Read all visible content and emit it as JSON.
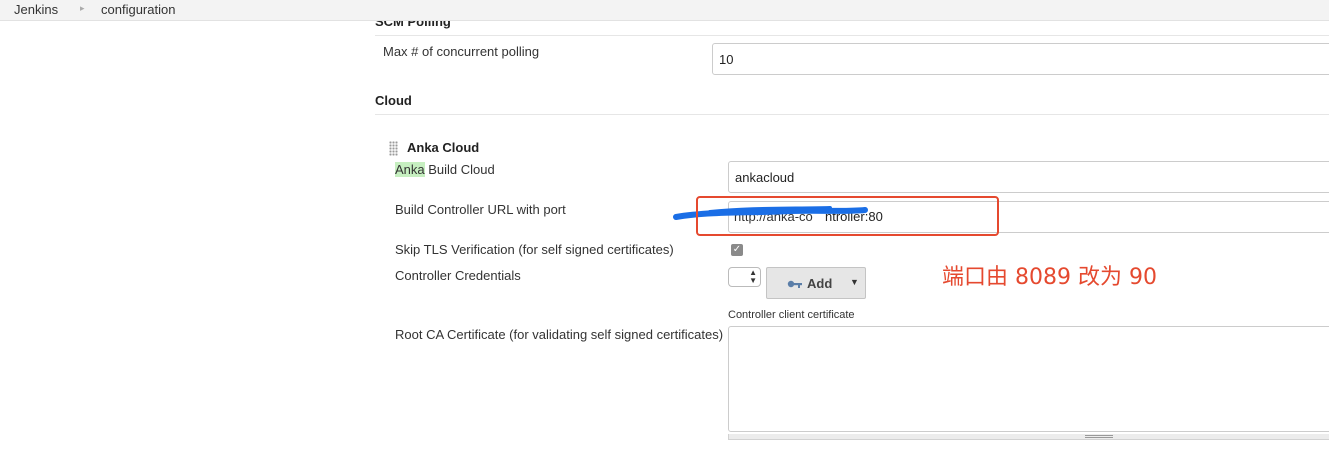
{
  "breadcrumb": {
    "items": [
      "Jenkins",
      "configuration"
    ]
  },
  "scm_polling": {
    "section_title": "SCM Polling",
    "max_concurrent_label": "Max # of concurrent polling",
    "max_concurrent_value": "10"
  },
  "cloud": {
    "section_title": "Cloud",
    "anka": {
      "title": "Anka Cloud",
      "name_label_highlight": "Anka",
      "name_label_rest": " Build Cloud",
      "name_value": "ankacloud",
      "url_label": "Build Controller URL with port",
      "url_value": "http://anka-controller:80",
      "url_visible_fragment": "ntroller:80",
      "skip_tls_label": "Skip TLS Verification (for self signed certificates)",
      "skip_tls_checked": true,
      "credentials_label": "Controller Credentials",
      "add_button_label": "Add",
      "client_cert_label": "Controller client certificate",
      "root_ca_label": "Root CA Certificate (for validating self signed certificates)",
      "root_ca_value": ""
    }
  },
  "annotation": {
    "text": "端口由 8089 改为 90",
    "color": "#e5492f",
    "scribble_color": "#1a6ee6"
  }
}
